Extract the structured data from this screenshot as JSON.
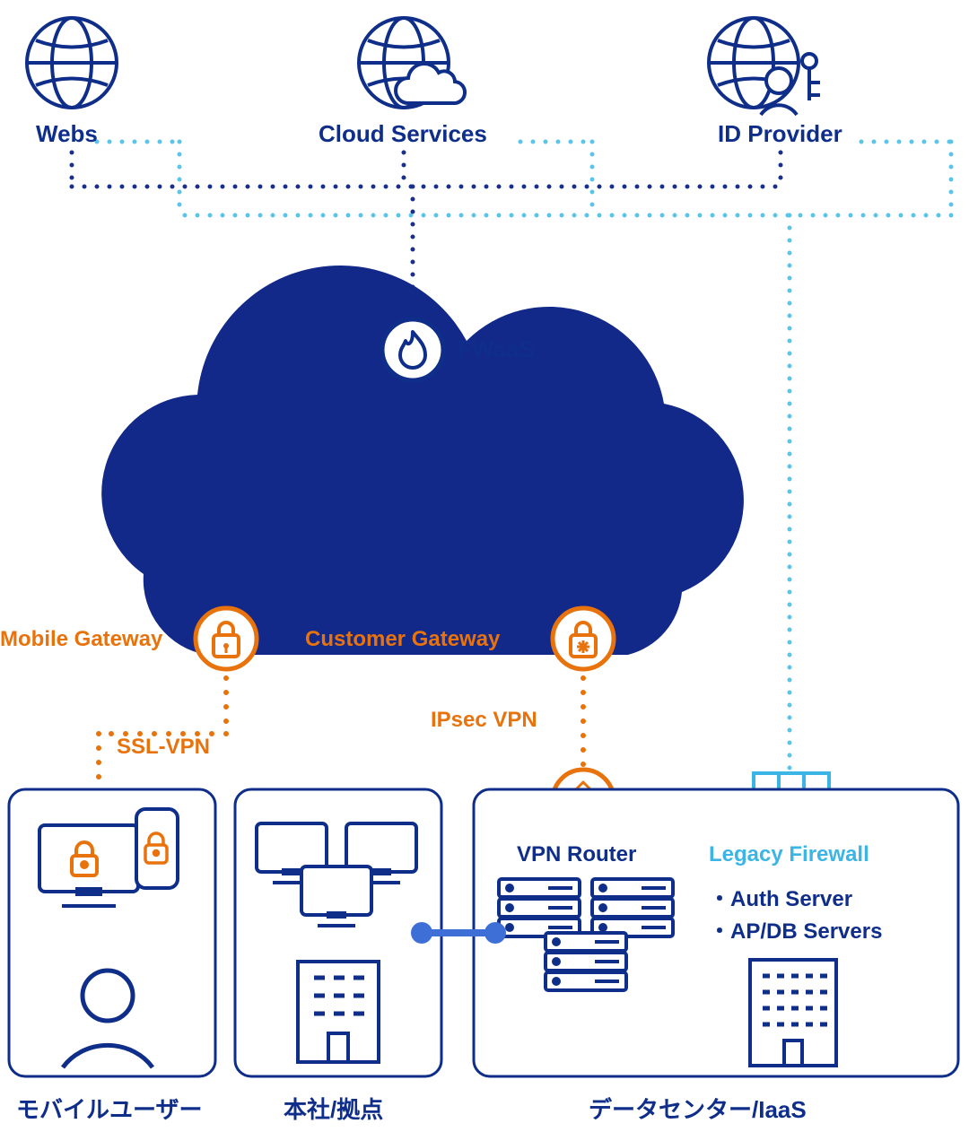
{
  "top": {
    "webs": "Webs",
    "cloud": "Cloud Services",
    "idp": "ID Provider"
  },
  "cloud": {
    "fwaas": "FWaaS",
    "mobileGateway": "Mobile Gateway",
    "customerGateway": "Customer Gateway"
  },
  "links": {
    "sslvpn": "SSL-VPN",
    "ipsec": "IPsec VPN"
  },
  "dc": {
    "vpnRouter": "VPN Router",
    "legacyFirewall": "Legacy Firewall",
    "authServer": "・Auth Server",
    "apdb": "・AP/DB Servers"
  },
  "bottom": {
    "mobile": "モバイルユーザー",
    "hq": "本社/拠点",
    "dc": "データセンター/IaaS"
  },
  "colors": {
    "navy": "#0f2e8a",
    "darkNavyFill": "#12298a",
    "orange": "#e8720c",
    "cyan": "#3bb5e6",
    "cyanDot": "#5bc4e8",
    "navyDot": "#1a2f8a",
    "whiteDot": "#ffffff",
    "linkBlue": "#3d6fd6"
  }
}
